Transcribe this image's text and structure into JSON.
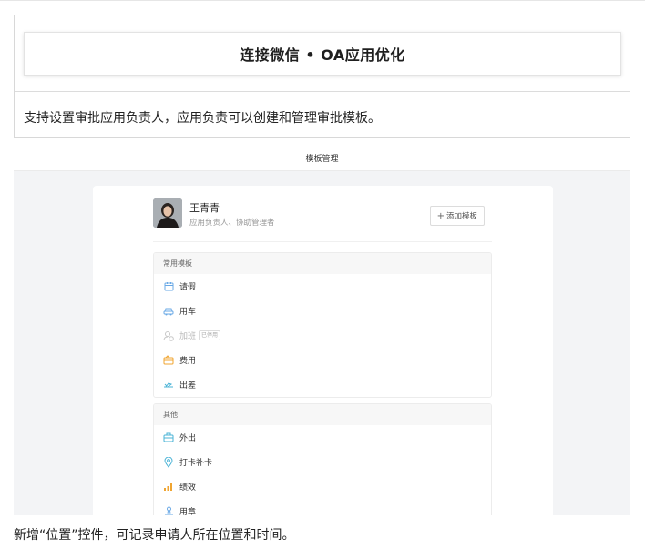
{
  "card": {
    "title": "连接微信 • OA应用优化",
    "description": "支持设置审批应用负责人，应用负责可以创建和管理审批模板。"
  },
  "screenshot": {
    "header_title": "模板管理",
    "user": {
      "name": "王青青",
      "role": "应用负责人、协助管理者"
    },
    "add_button": {
      "icon": "plus-icon",
      "label": "添加模板"
    },
    "groups": [
      {
        "title": "常用模板",
        "items": [
          {
            "label": "请假",
            "icon": "calendar-icon",
            "color": "#6aa9e6"
          },
          {
            "label": "用车",
            "icon": "car-icon",
            "color": "#6aa9e6"
          },
          {
            "label": "加班",
            "icon": "overtime-icon",
            "color": "#c8c8c8",
            "tag": "已停用"
          },
          {
            "label": "费用",
            "icon": "wallet-icon",
            "color": "#f0a531"
          },
          {
            "label": "出差",
            "icon": "plane-icon",
            "color": "#4ab3d6"
          }
        ]
      },
      {
        "title": "其他",
        "items": [
          {
            "label": "外出",
            "icon": "briefcase-icon",
            "color": "#4ab3d6"
          },
          {
            "label": "打卡补卡",
            "icon": "location-pin-icon",
            "color": "#4ab3d6"
          },
          {
            "label": "绩效",
            "icon": "bar-chart-icon",
            "color": "#f0a531"
          },
          {
            "label": "用章",
            "icon": "stamp-icon",
            "color": "#6aa9e6"
          }
        ]
      }
    ]
  },
  "footer": {
    "text": "新增“位置”控件，可记录申请人所在位置和时间。"
  }
}
